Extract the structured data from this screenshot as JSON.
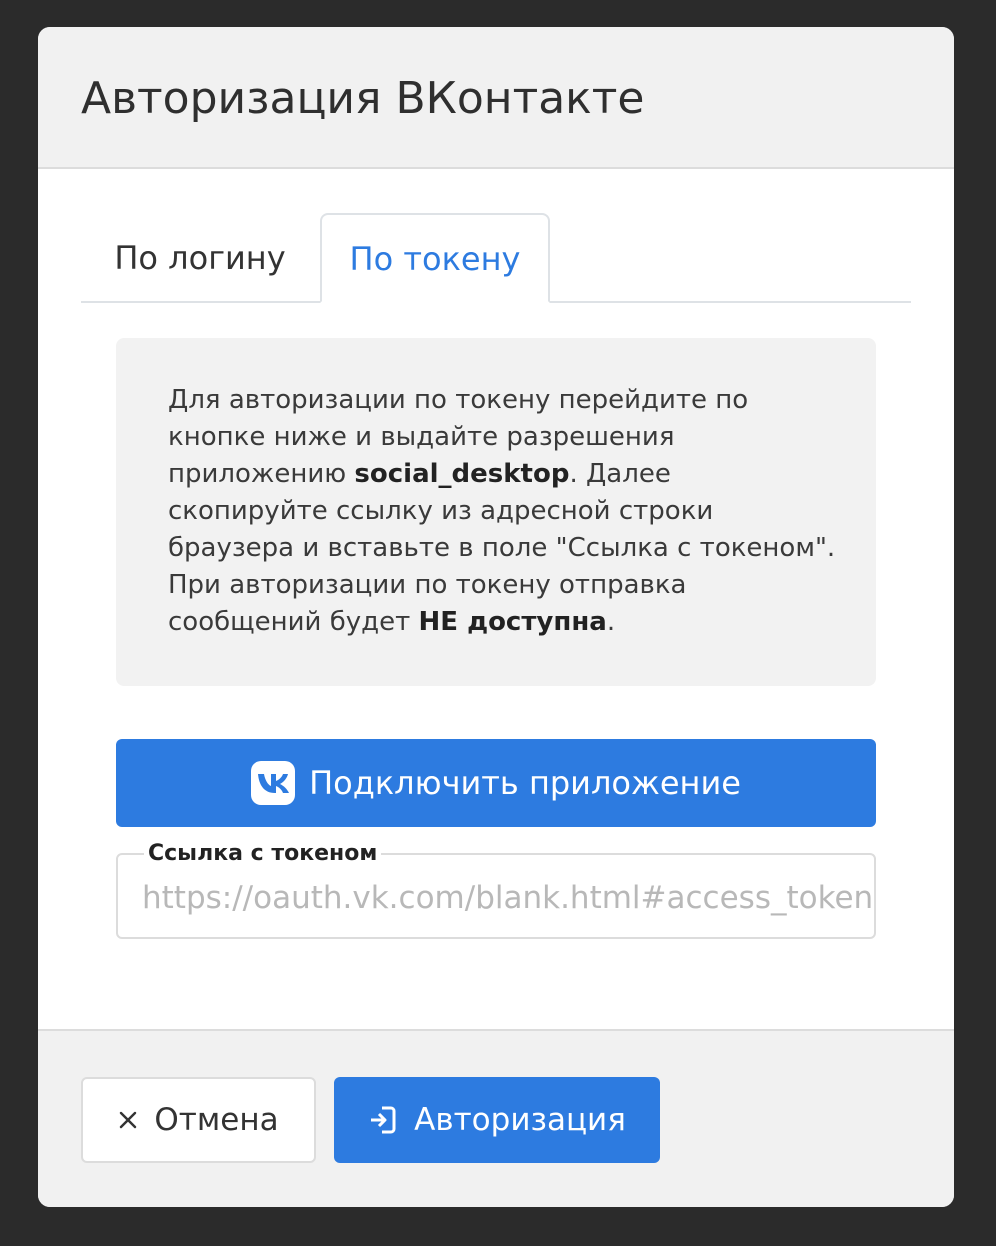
{
  "modal": {
    "title": "Авторизация ВКонтакте"
  },
  "tabs": [
    {
      "label": "По логину",
      "active": false
    },
    {
      "label": "По токену",
      "active": true
    }
  ],
  "info": {
    "part1": "Для авторизации по токену перейдите по кнопке ниже и выдайте разрешения приложению ",
    "app_name": "social_desktop",
    "part2": ". Далее скопируйте ссылку из адресной строки браузера и вставьте в поле \"Ссылка с токеном\". При авторизации по токену отправка сообщений будет ",
    "emphasis": "НЕ доступна",
    "part3": "."
  },
  "connect_button": {
    "label": "Подключить приложение",
    "icon": "vk-logo-icon"
  },
  "token_field": {
    "label": "Ссылка с токеном",
    "placeholder": "https://oauth.vk.com/blank.html#access_token=",
    "value": ""
  },
  "footer": {
    "cancel_label": "Отмена",
    "cancel_icon": "close-icon",
    "auth_label": "Авторизация",
    "auth_icon": "sign-in-icon"
  },
  "colors": {
    "accent": "#2d7be0",
    "header_bg": "#f1f1f1",
    "backdrop": "#2b2b2b"
  }
}
